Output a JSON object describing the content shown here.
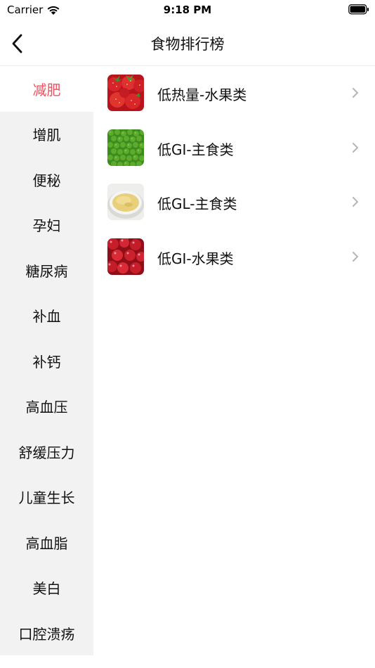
{
  "status_bar": {
    "carrier": "Carrier",
    "time": "9:18 PM"
  },
  "nav": {
    "title": "食物排行榜",
    "back_icon": "chevron-left-icon"
  },
  "sidebar": {
    "items": [
      {
        "label": "减肥",
        "active": true
      },
      {
        "label": "增肌"
      },
      {
        "label": "便秘"
      },
      {
        "label": "孕妇"
      },
      {
        "label": "糖尿病"
      },
      {
        "label": "补血"
      },
      {
        "label": "补钙"
      },
      {
        "label": "高血压"
      },
      {
        "label": "舒缓压力"
      },
      {
        "label": "儿童生长"
      },
      {
        "label": "高血脂"
      },
      {
        "label": "美白"
      },
      {
        "label": "口腔溃疡"
      }
    ]
  },
  "list": {
    "items": [
      {
        "label": "低热量-水果类",
        "thumb": "strawberries"
      },
      {
        "label": "低GI-主食类",
        "thumb": "green-peas"
      },
      {
        "label": "低GL-主食类",
        "thumb": "corn-porridge"
      },
      {
        "label": "低GI-水果类",
        "thumb": "cherries"
      }
    ]
  },
  "colors": {
    "accent": "#f0505f",
    "sidebar_bg": "#f2f2f2",
    "chevron": "#b5b5b5"
  }
}
